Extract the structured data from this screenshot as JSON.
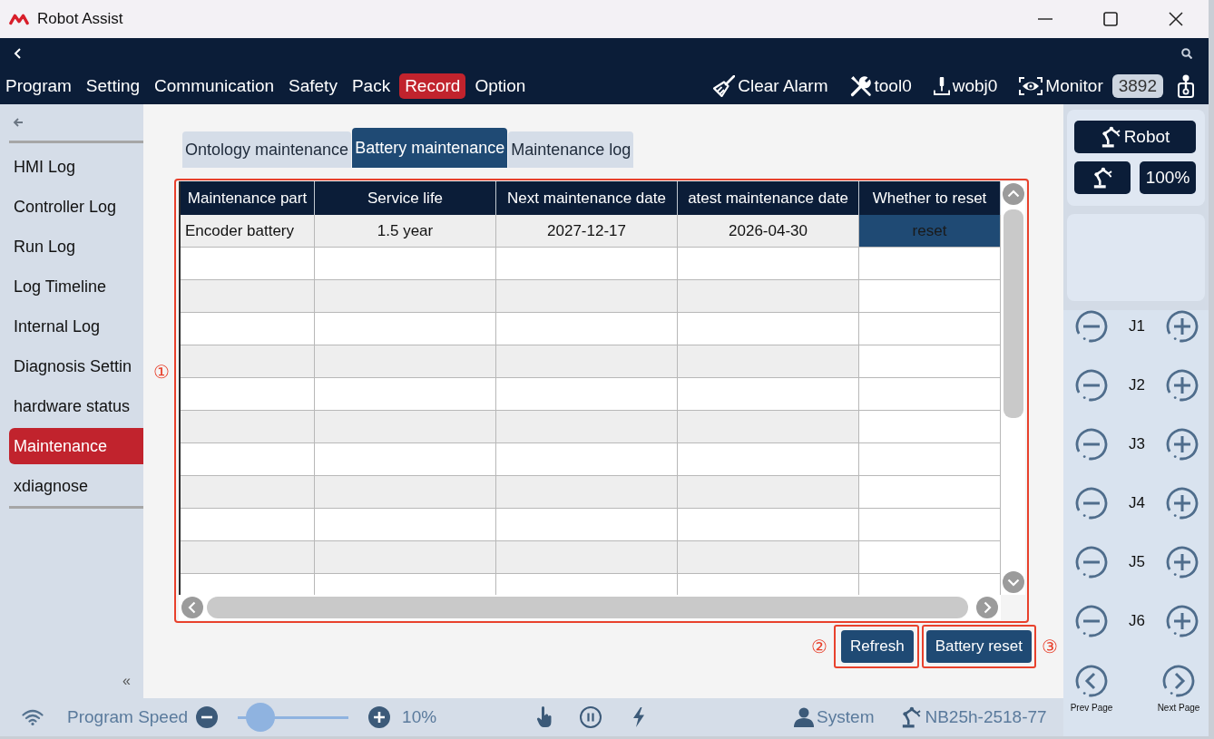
{
  "window": {
    "title": "Robot Assist"
  },
  "nav": {
    "menu": [
      {
        "label": "Program",
        "selected": false
      },
      {
        "label": "Setting",
        "selected": false
      },
      {
        "label": "Communication",
        "selected": false
      },
      {
        "label": "Safety",
        "selected": false
      },
      {
        "label": "Pack",
        "selected": false
      },
      {
        "label": "Record",
        "selected": true
      },
      {
        "label": "Option",
        "selected": false
      }
    ],
    "tools": [
      {
        "kind": "clear_alarm",
        "label": "Clear Alarm"
      },
      {
        "kind": "tool",
        "label": "tool0"
      },
      {
        "kind": "work_object",
        "label": "wobj0"
      },
      {
        "kind": "monitor",
        "label": "Monitor",
        "badge": "3892"
      }
    ]
  },
  "sidebar": {
    "items": [
      {
        "label": "HMI Log",
        "selected": false
      },
      {
        "label": "Controller Log",
        "selected": false
      },
      {
        "label": "Run Log",
        "selected": false
      },
      {
        "label": "Log Timeline",
        "selected": false
      },
      {
        "label": "Internal Log",
        "selected": false
      },
      {
        "label": "Diagnosis Settin",
        "selected": false
      },
      {
        "label": "hardware status",
        "selected": false
      },
      {
        "label": "Maintenance",
        "selected": true
      },
      {
        "label": "xdiagnose",
        "selected": false
      }
    ],
    "collapse": "«"
  },
  "tabs": [
    {
      "label": "Ontology maintenance",
      "selected": false
    },
    {
      "label": "Battery maintenance",
      "selected": true
    },
    {
      "label": "Maintenance log",
      "selected": false
    }
  ],
  "table": {
    "callout": "①",
    "columns": [
      "Maintenance part",
      "Service life",
      "Next maintenance date",
      "atest maintenance date",
      "Whether to reset"
    ],
    "rows": [
      {
        "cells": [
          "Encoder battery",
          "1.5 year",
          "2027-12-17",
          "2026-04-30"
        ],
        "action": "reset"
      }
    ]
  },
  "buttons": [
    {
      "label": "Refresh",
      "callout": "②"
    },
    {
      "label": "Battery reset",
      "callout": "③"
    }
  ],
  "right_panel": {
    "robot": "Robot",
    "speed": "100%",
    "joints": [
      "J1",
      "J2",
      "J3",
      "J4",
      "J5",
      "J6"
    ],
    "prev_page": "Prev Page",
    "next_page": "Next Page"
  },
  "status_bar": {
    "label": "Program Speed",
    "speed": {
      "level": 0.1
    },
    "reading": "10%",
    "user": "System",
    "controller": "NB25h-2518-77"
  }
}
